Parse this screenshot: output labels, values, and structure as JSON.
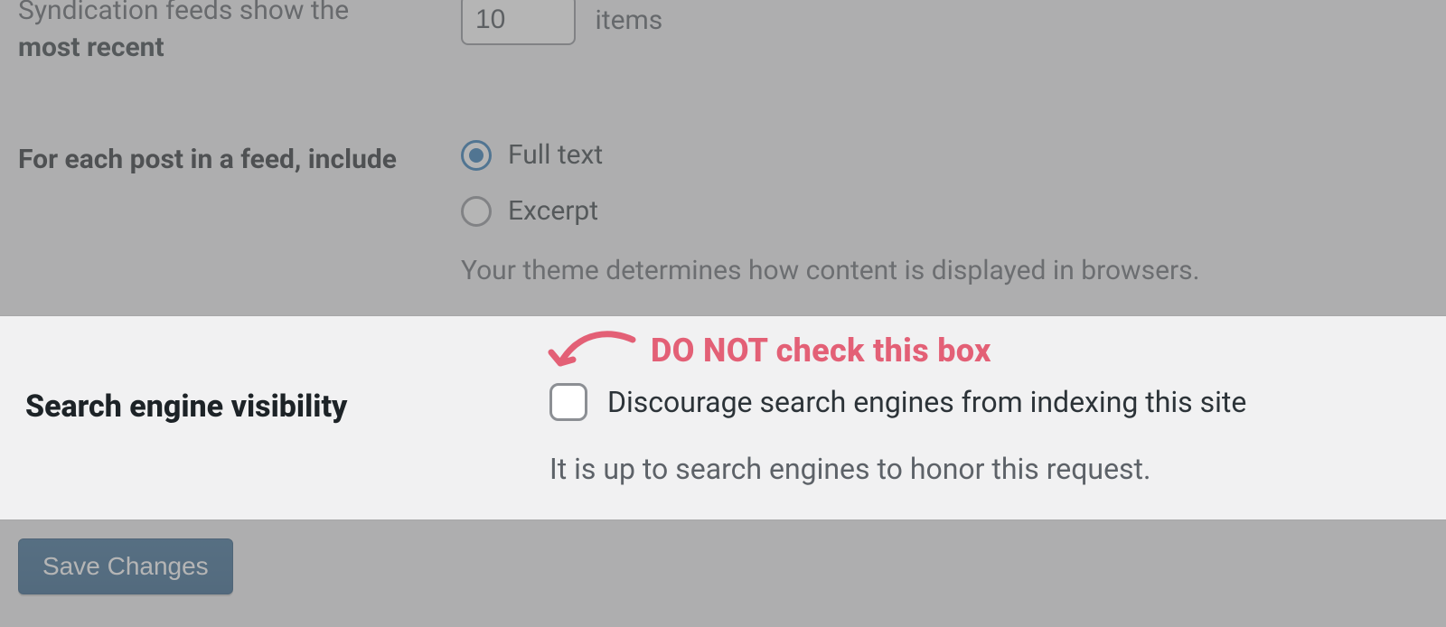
{
  "rows": {
    "syndication": {
      "label_line1": "Syndication feeds show the",
      "label_line2": "most recent",
      "value": "10",
      "suffix": "items"
    },
    "feed": {
      "label": "For each post in a feed, include",
      "options": {
        "full_text": "Full text",
        "excerpt": "Excerpt"
      },
      "description": "Your theme determines how content is displayed in browsers."
    },
    "visibility": {
      "label": "Search engine visibility",
      "checkbox_label": "Discourage search engines from indexing this site",
      "description": "It is up to search engines to honor this request."
    }
  },
  "submit": {
    "label": "Save Changes"
  },
  "annotation": {
    "text": "DO NOT check this box",
    "color": "#e36076"
  }
}
